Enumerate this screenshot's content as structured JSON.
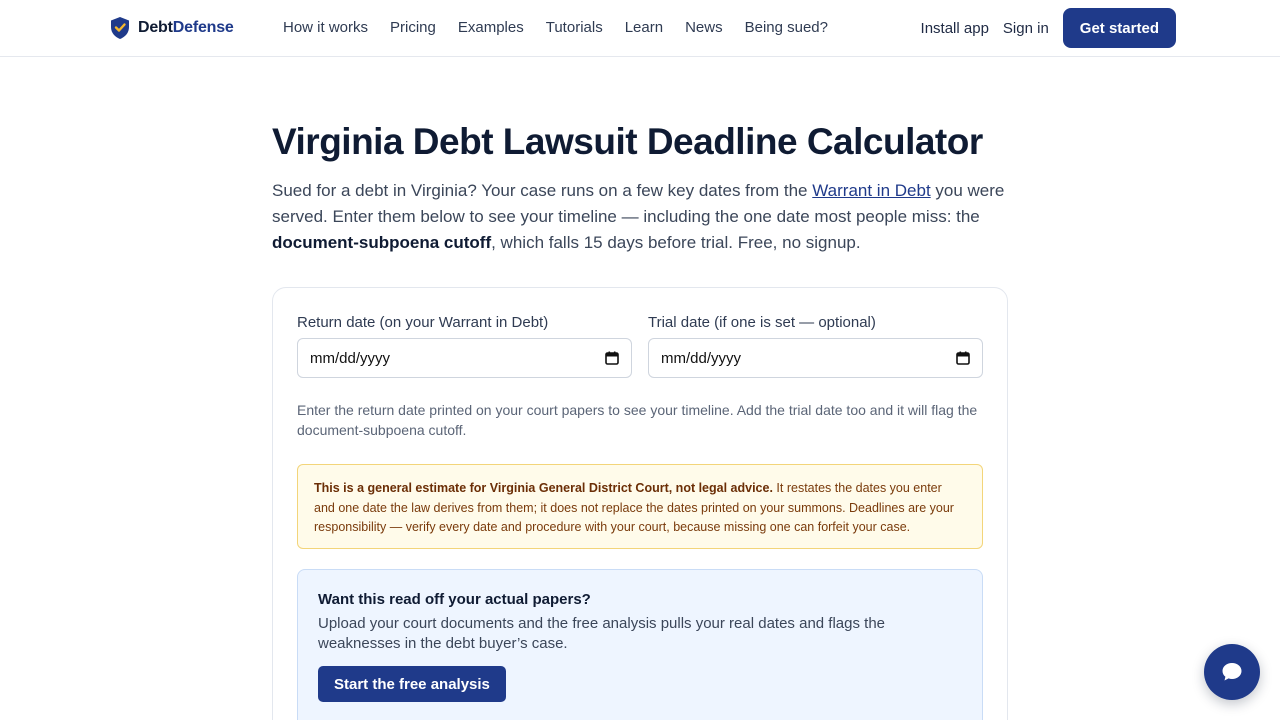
{
  "header": {
    "logo_part1": "Debt",
    "logo_part2": "Defense",
    "nav": [
      "How it works",
      "Pricing",
      "Examples",
      "Tutorials",
      "Learn",
      "News",
      "Being sued?"
    ],
    "install_app": "Install app",
    "sign_in": "Sign in",
    "get_started": "Get started"
  },
  "main": {
    "title": "Virginia Debt Lawsuit Deadline Calculator",
    "intro_before_link": "Sued for a debt in Virginia? Your case runs on a few key dates from the ",
    "intro_link": "Warrant in Debt",
    "intro_after_link": " you were served. Enter them below to see your timeline — including the one date most people miss: the ",
    "intro_bold": "document-subpoena cutoff",
    "intro_end": ", which falls 15 days before trial. Free, no signup."
  },
  "form": {
    "return_label": "Return date (on your Warrant in Debt)",
    "return_placeholder": "mm/dd/yyyy",
    "trial_label": "Trial date (if one is set — optional)",
    "trial_placeholder": "mm/dd/yyyy",
    "hint": "Enter the return date printed on your court papers to see your timeline. Add the trial date too and it will flag the document-subpoena cutoff."
  },
  "warning": {
    "bold": "This is a general estimate for Virginia General District Court, not legal advice.",
    "text": " It restates the dates you enter and one date the law derives from them; it does not replace the dates printed on your summons. Deadlines are your responsibility — verify every date and procedure with your court, because missing one can forfeit your case."
  },
  "cta": {
    "heading": "Want this read off your actual papers?",
    "body": "Upload your court documents and the free analysis pulls your real dates and flags the weaknesses in the debt buyer’s case.",
    "button": "Start the free analysis"
  },
  "icons": {
    "logo": "shield-check-icon",
    "date": "calendar-icon",
    "chat": "chat-bubble-icon"
  },
  "colors": {
    "brand": "#1f3a8a",
    "warning_bg": "#fffbea",
    "cta_bg": "#eef5ff"
  }
}
